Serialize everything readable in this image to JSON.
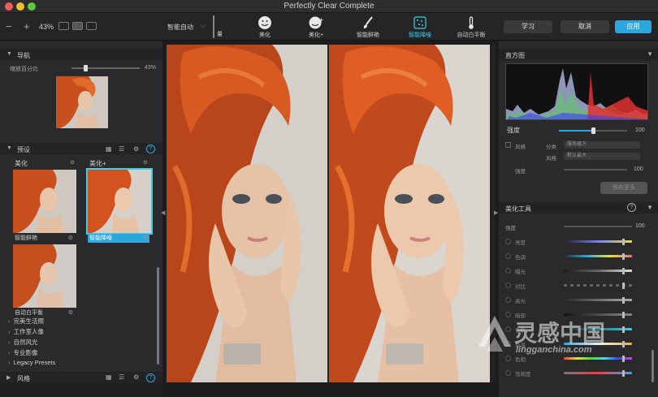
{
  "window": {
    "title": "Perfectly Clear Complete"
  },
  "toolbar": {
    "zoom_value": "43%",
    "preset_selector": "智能自动",
    "cut_tool_label": "量",
    "tools": [
      {
        "label": "美化",
        "icon": "face-icon"
      },
      {
        "label": "美化+",
        "icon": "face-plus-icon"
      },
      {
        "label": "智能鲜艳",
        "icon": "brush-icon"
      },
      {
        "label": "智能降噪",
        "icon": "noise-icon",
        "active": true
      },
      {
        "label": "自动白平衡",
        "icon": "thermometer-icon"
      }
    ]
  },
  "header_buttons": {
    "learn": "学习",
    "cancel": "取消",
    "apply": "应用"
  },
  "navigator": {
    "title": "导航",
    "zoom_label": "缩放百分比",
    "zoom_pct": "43%",
    "zoom_fraction": 0.2
  },
  "presets": {
    "title": "预设",
    "help": "?",
    "captions": [
      "美化",
      "美化+"
    ],
    "items": [
      {
        "name": "智能鲜艳",
        "selected": false
      },
      {
        "name": "智能降噪",
        "selected": true
      },
      {
        "name": "自动白平衡",
        "selected": false
      }
    ],
    "groups": [
      "完美生活照",
      "工作室人像",
      "自然风光",
      "专业影像",
      "Legacy Presets"
    ]
  },
  "styles_section": {
    "title": "风格"
  },
  "histogram": {
    "title": "直方图"
  },
  "strength": {
    "label": "强度",
    "value": "100",
    "fraction": 0.5,
    "sub_label": "风格",
    "row1_small": "分类",
    "row1_dd": "服务器方",
    "row2_small": "风格",
    "row2_dd": "默认最大",
    "row3_label": "强度",
    "row3_value": "100",
    "button": "保存更多"
  },
  "beautify_tools": {
    "title": "美化工具",
    "top_label": "强度",
    "top_value": "100",
    "help": "?",
    "rows": [
      {
        "label": "亮度",
        "gradient": "linear-gradient(90deg,#222,#7a7aff,#e5e540)"
      },
      {
        "label": "色调",
        "gradient": "linear-gradient(90deg,#2a2a2a,#2aa7dd,#e5e540,#f07070)"
      },
      {
        "label": "曝光",
        "gradient": "linear-gradient(90deg,#1a1a1a,#666,#e0e0e0)"
      },
      {
        "label": "对比",
        "gradient": "repeating-linear-gradient(90deg,#666 0 4px,#2a2a2a 4px 8px)"
      },
      {
        "label": "高光",
        "gradient": "linear-gradient(90deg,#2a2a2a,#aaa)"
      },
      {
        "label": "暗部",
        "gradient": "linear-gradient(90deg,#111,#888)"
      },
      {
        "label": "色阶",
        "gradient": "linear-gradient(90deg,#222,#3ad0ea)"
      },
      {
        "label": "色温",
        "gradient": "linear-gradient(90deg,#2aa7dd,#eeeeee,#f0b040)"
      },
      {
        "label": "色相",
        "gradient": "linear-gradient(90deg,#f04040,#e0e040,#40e040,#40e0e0,#4040f0,#e040e0)"
      },
      {
        "label": "饱和度",
        "gradient": "linear-gradient(90deg,#777,#f04040,#40a0f0)"
      }
    ]
  },
  "watermark": {
    "cn": "灵感中国",
    "en": "lingganchina.com"
  },
  "colors": {
    "accent": "#2aa7dd",
    "active_tool": "#3ad0ea",
    "hair": "#d2531f",
    "bg": "#2a2a2c"
  }
}
